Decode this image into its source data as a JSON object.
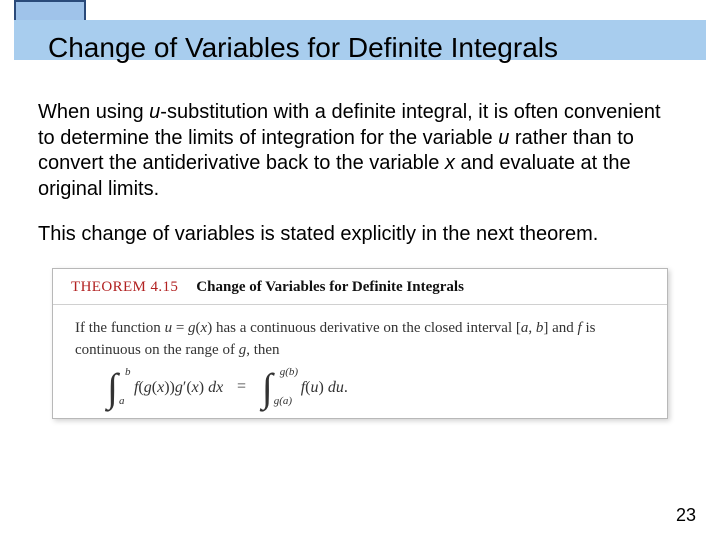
{
  "slide": {
    "title": "Change of Variables for Definite Integrals",
    "page_number": "23"
  },
  "paragraphs": {
    "p1_a": "When using ",
    "p1_u": "u",
    "p1_b": "-substitution with a definite integral, it is often convenient to determine the limits of integration for the variable ",
    "p1_u2": "u",
    "p1_c": " rather than to convert the antiderivative back to the variable ",
    "p1_x": "x",
    "p1_d": " and evaluate at the original limits.",
    "p2": "This change of variables is stated explicitly in the next theorem."
  },
  "theorem": {
    "tag": "THEOREM 4.15",
    "title": "Change of Variables for Definite Integrals",
    "body_a": "If the function ",
    "body_u": "u",
    "body_eq": " = ",
    "body_g": "g",
    "body_paren": "(",
    "body_x": "x",
    "body_paren2": ") has a continuous derivative on the closed interval [",
    "body_ab1": "a",
    "body_comma": ", ",
    "body_ab2": "b",
    "body_close": "] and ",
    "body_f": "f",
    "body_rest": " is continuous on the range of ",
    "body_g2": "g",
    "body_then": ", then",
    "int1_lower": "a",
    "int1_upper": "b",
    "int1_body_a": "f",
    "int1_body_b": "(",
    "int1_body_c": "g",
    "int1_body_d": "(",
    "int1_body_e": "x",
    "int1_body_f": "))",
    "int1_body_g": "g",
    "int1_body_h": "′(",
    "int1_body_i": "x",
    "int1_body_j": ") ",
    "int1_body_dx": "dx",
    "equals": "=",
    "int2_lower": "g(a)",
    "int2_upper": "g(b)",
    "int2_body_a": "f",
    "int2_body_b": "(",
    "int2_body_c": "u",
    "int2_body_d": ") ",
    "int2_body_du": "du",
    "period": "."
  }
}
